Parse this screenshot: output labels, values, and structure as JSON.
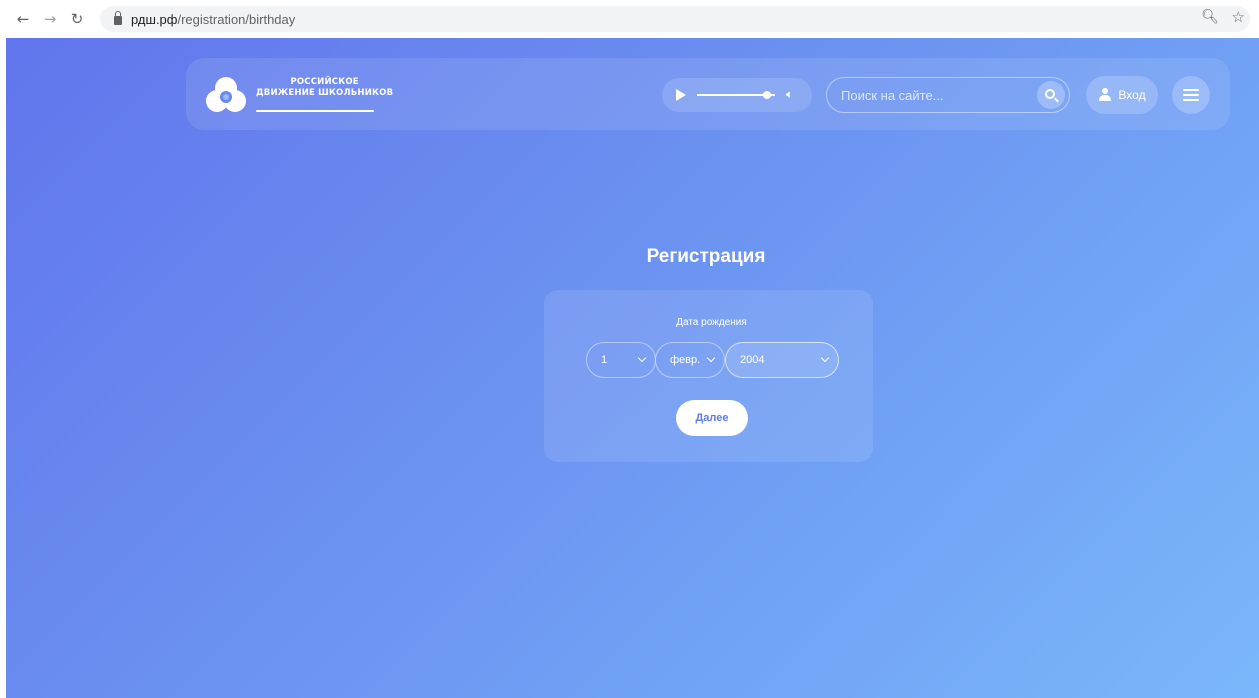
{
  "browser": {
    "back_icon": "arrow-left-icon",
    "forward_icon": "arrow-right-icon",
    "reload_icon": "reload-icon",
    "url_host": "рдш.рф",
    "url_path": "/registration/birthday",
    "zoom_icon": "zoom-icon",
    "star_icon": "bookmark-star-icon"
  },
  "header": {
    "logo_line1": "РОССИЙСКОЕ",
    "logo_line2": "ДВИЖЕНИЕ ШКОЛЬНИКОВ",
    "player": {
      "progress": 0.9
    },
    "search_placeholder": "Поиск на сайте...",
    "login_label": "Вход"
  },
  "registration": {
    "title": "Регистрация",
    "birthday_label": "Дата рождения",
    "day": "1",
    "month": "февр.",
    "year": "2004",
    "next_label": "Далее"
  },
  "colors": {
    "gradient_start": "#6175ec",
    "gradient_end": "#7ab7fb",
    "button_text": "#5d7de8"
  }
}
